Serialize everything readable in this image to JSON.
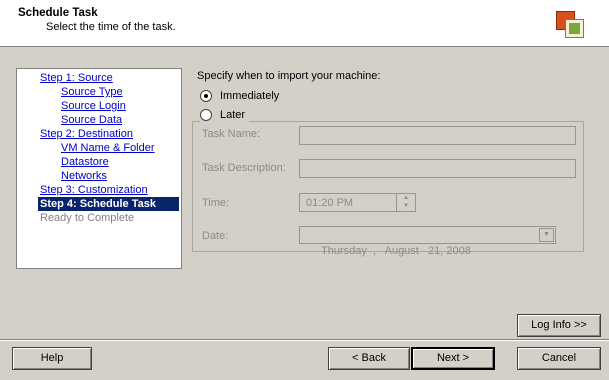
{
  "header": {
    "title": "Schedule Task",
    "subtitle": "Select the time of the task."
  },
  "nav": {
    "items": [
      {
        "label": "Step 1: Source",
        "type": "step"
      },
      {
        "label": "Source Type",
        "type": "sub"
      },
      {
        "label": "Source Login",
        "type": "sub"
      },
      {
        "label": "Source Data",
        "type": "sub"
      },
      {
        "label": "Step 2: Destination",
        "type": "step"
      },
      {
        "label": "VM Name & Folder",
        "type": "sub"
      },
      {
        "label": "Datastore",
        "type": "sub"
      },
      {
        "label": "Networks",
        "type": "sub"
      },
      {
        "label": "Step 3: Customization",
        "type": "step"
      },
      {
        "label": "Step 4: Schedule Task",
        "type": "active"
      },
      {
        "label": "Ready to Complete",
        "type": "disabled"
      }
    ]
  },
  "main": {
    "prompt": "Specify when to import your machine:",
    "immediately_label": "Immediately",
    "later_label": "Later",
    "selected": "Immediately",
    "task_name_label": "Task Name:",
    "task_name_value": "",
    "task_description_label": "Task Description:",
    "task_description_value": "",
    "time_label": "Time:",
    "time_value": "01:20 PM",
    "date_label": "Date:",
    "date_value": "Thursday  ,   August   21, 2008"
  },
  "buttons": {
    "log_info": "Log Info >>",
    "help": "Help",
    "back": "< Back",
    "next": "Next >",
    "cancel": "Cancel"
  }
}
